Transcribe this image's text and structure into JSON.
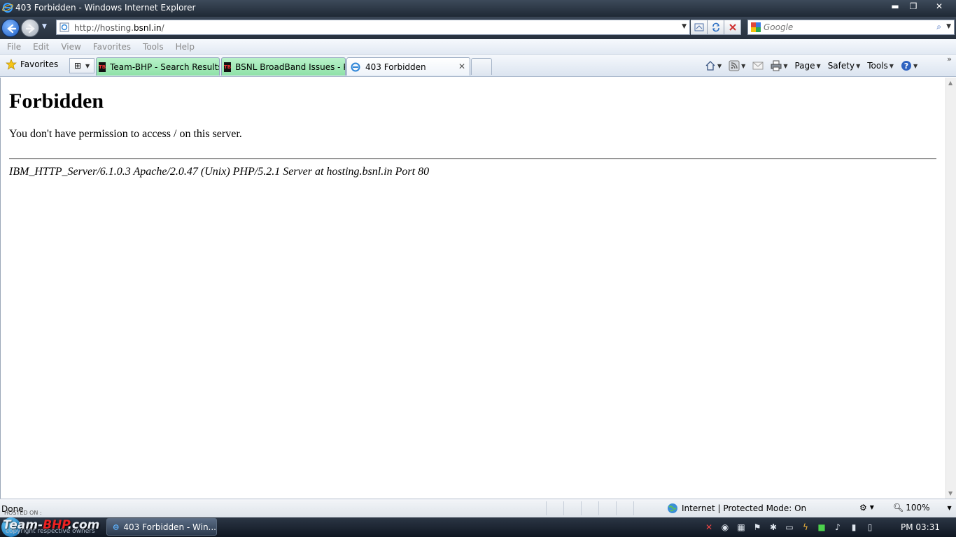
{
  "window": {
    "title": "403 Forbidden - Windows Internet Explorer",
    "minimize_glyph": "▬",
    "restore_glyph": "❐",
    "close_glyph": "✕"
  },
  "address_bar": {
    "url_prefix": "http://hosting.",
    "url_domain": "bsnl.in",
    "url_suffix": "/"
  },
  "search": {
    "placeholder": "Google"
  },
  "menu": [
    "File",
    "Edit",
    "View",
    "Favorites",
    "Tools",
    "Help"
  ],
  "favorites_label": "Favorites",
  "tabs": [
    {
      "label": "Team-BHP - Search Results",
      "favicon": "TB"
    },
    {
      "label": "BSNL BroadBand Issues - P...",
      "favicon": "TB"
    },
    {
      "label": "403 Forbidden",
      "favicon": "ie-icon"
    }
  ],
  "command_bar": {
    "page": "Page",
    "safety": "Safety",
    "tools": "Tools"
  },
  "content": {
    "heading": "Forbidden",
    "message": "You don't have permission to access / on this server.",
    "server_signature": "IBM_HTTP_Server/6.1.0.3 Apache/2.0.47 (Unix) PHP/5.2.1 Server at hosting.bsnl.in Port 80"
  },
  "status_bar": {
    "status": "Done",
    "zone": "Internet | Protected Mode: On",
    "zoom": "100%"
  },
  "taskbar": {
    "window_button": "403 Forbidden - Win...",
    "clock": "PM 03:31"
  },
  "watermark": {
    "hosted": "HOSTED ON :",
    "brand_a": "Team-",
    "brand_b": "BHP",
    "brand_c": ".com",
    "subtext": "copyright respective owners"
  },
  "colors": {
    "tab_green": "#8fe1a8",
    "title_bar": "#1f2935",
    "brand_red": "#e22"
  }
}
